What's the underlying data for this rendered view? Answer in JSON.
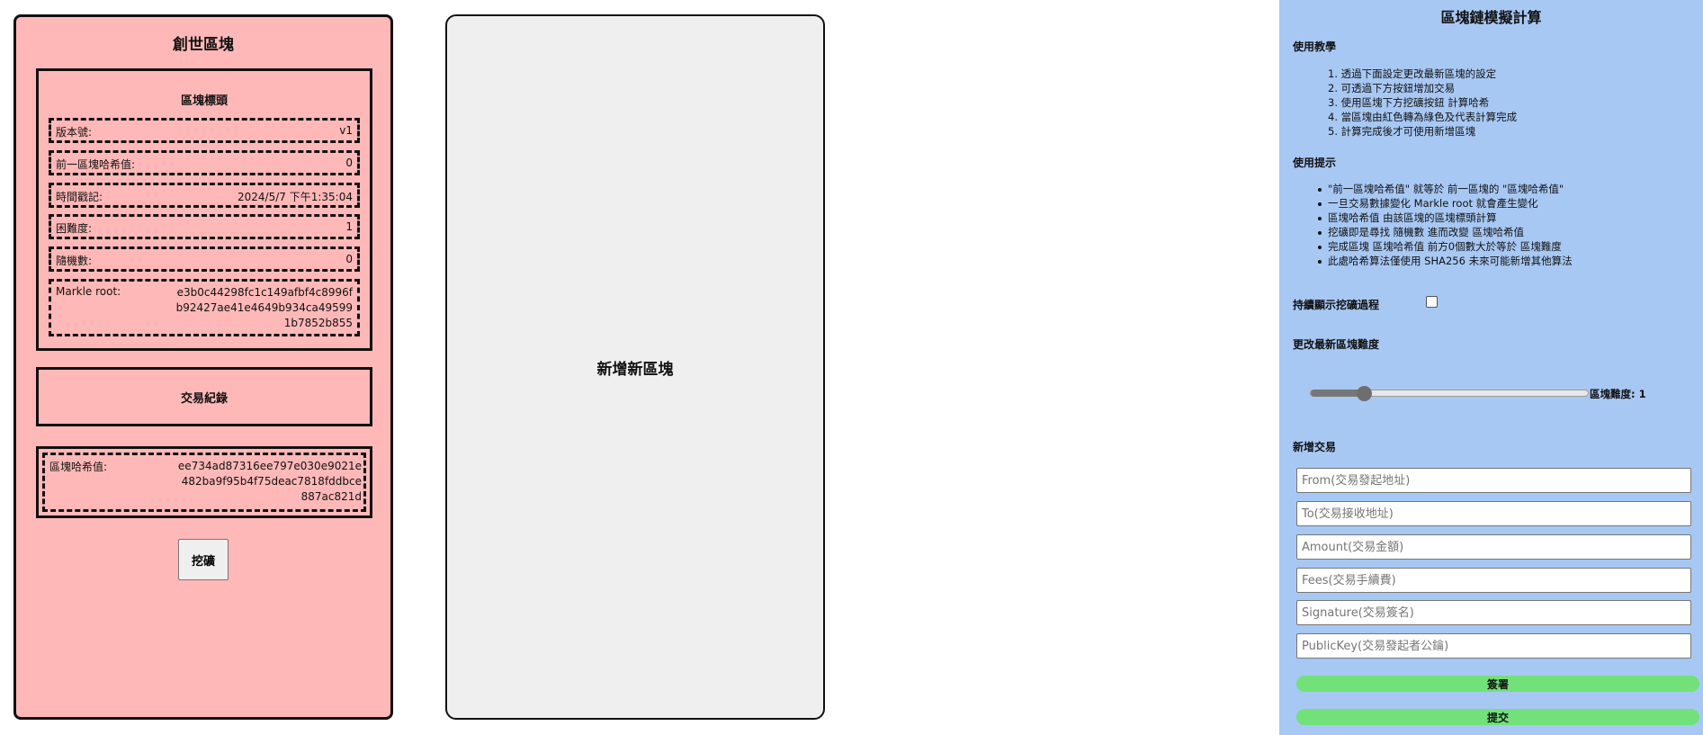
{
  "genesis_block": {
    "title": "創世區塊",
    "header": {
      "title": "區塊標頭",
      "version_label": "版本號:",
      "version_value": "v1",
      "prev_hash_label": "前一區塊哈希值:",
      "prev_hash_value": "0",
      "timestamp_label": "時間戳記:",
      "timestamp_value": "2024/5/7 下午1:35:04",
      "difficulty_label": "困難度:",
      "difficulty_value": "1",
      "nonce_label": "隨機數:",
      "nonce_value": "0",
      "merkle_label": "Markle root:",
      "merkle_value": "e3b0c44298fc1c149afbf4c8996fb92427ae41e4649b934ca495991b7852b855"
    },
    "transactions_label": "交易紀錄",
    "block_hash_label": "區塊哈希值:",
    "block_hash_value": "ee734ad87316ee797e030e9021e482ba9f95b4f75deac7818fddbce887ac821d",
    "mine_button": "挖礦"
  },
  "new_block_card": {
    "label": "新增新區塊"
  },
  "panel": {
    "title": "區塊鏈模擬計算",
    "instructions_heading": "使用教學",
    "instructions": [
      "1. 透過下面設定更改最新區塊的設定",
      "2. 可透過下方按鈕增加交易",
      "3. 使用區塊下方挖礦按鈕 計算哈希",
      "4. 當區塊由紅色轉為綠色及代表計算完成",
      "5. 計算完成後才可使用新增區塊"
    ],
    "tips_heading": "使用提示",
    "tips": [
      "\"前一區塊哈希值\" 就等於 前一區塊的 \"區塊哈希值\"",
      "一旦交易數據變化 Markle root 就會產生變化",
      "區塊哈希值 由該區塊的區塊標頭計算",
      "挖礦即是尋找 隨機數 進而改變 區塊哈希值",
      "完成區塊 區塊哈希值 前方0個數大於等於 區塊難度",
      "此處哈希算法僅使用 SHA256 未來可能新增其他算法"
    ],
    "show_mining_label": "持續顯示挖礦過程",
    "show_mining_checked": false,
    "difficulty_heading": "更改最新區塊難度",
    "difficulty_slider_fraction": 0.19,
    "difficulty_label": "區塊難度: 1",
    "add_tx_heading": "新增交易",
    "inputs": {
      "from_placeholder": "From(交易發起地址)",
      "to_placeholder": "To(交易接收地址)",
      "amount_placeholder": "Amount(交易金額)",
      "fees_placeholder": "Fees(交易手續費)",
      "signature_placeholder": "Signature(交易簽名)",
      "publickey_placeholder": "PublicKey(交易發起者公鑰)"
    },
    "sign_button": "簽署",
    "submit_button": "提交"
  },
  "colors": {
    "block_unmined": "#ffb8b8",
    "new_block_bg": "#efefef",
    "panel_bg": "#a8c8f4",
    "button_green": "#72e17a"
  }
}
